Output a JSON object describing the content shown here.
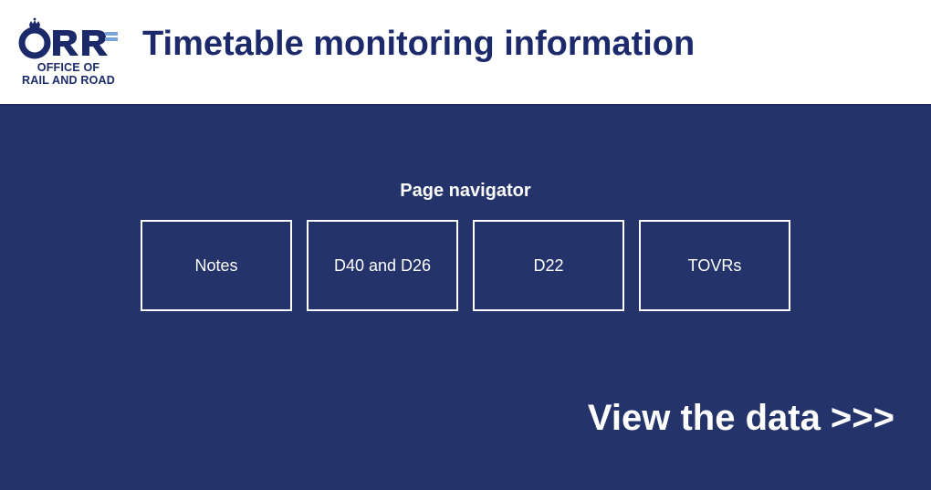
{
  "header": {
    "logo": {
      "line1": "OFFICE OF",
      "line2": "RAIL AND ROAD"
    },
    "title": "Timetable monitoring information"
  },
  "content": {
    "nav_label": "Page navigator",
    "buttons": [
      {
        "label": "Notes"
      },
      {
        "label": "D40 and D26"
      },
      {
        "label": "D22"
      },
      {
        "label": "TOVRs"
      }
    ],
    "view_data": "View the data >>>"
  }
}
